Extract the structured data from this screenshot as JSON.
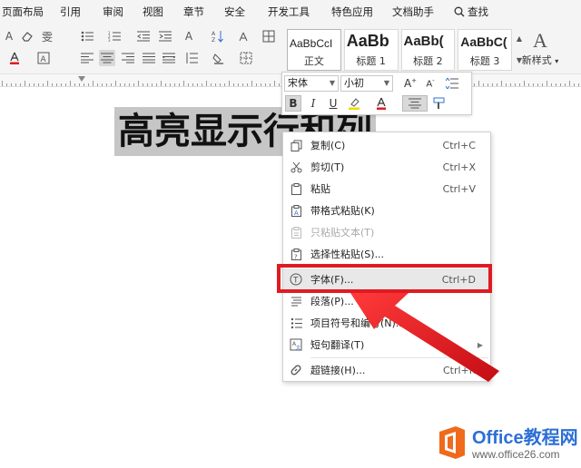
{
  "menubar": {
    "items": [
      "页面布局",
      "引用",
      "审阅",
      "视图",
      "章节",
      "安全",
      "开发工具",
      "特色应用",
      "文档助手"
    ],
    "search_label": "查找"
  },
  "ribbon": {
    "styles": [
      {
        "sample": "AaBbCcI",
        "name": "正文"
      },
      {
        "sample": "AaBb",
        "name": "标题 1"
      },
      {
        "sample": "AaBb(",
        "name": "标题 2"
      },
      {
        "sample": "AaBbC(",
        "name": "标题 3"
      }
    ],
    "new_style_label": "新样式",
    "new_style_glyph": "A"
  },
  "document": {
    "heading": "高亮显示行和列"
  },
  "minibar": {
    "font_name": "宋体",
    "font_size": "小初"
  },
  "context_menu": {
    "items": [
      {
        "label": "复制(C)",
        "shortcut": "Ctrl+C",
        "icon": "copy-icon",
        "enabled": true
      },
      {
        "label": "剪切(T)",
        "shortcut": "Ctrl+X",
        "icon": "scissors-icon",
        "enabled": true
      },
      {
        "label": "粘贴",
        "shortcut": "Ctrl+V",
        "icon": "paste-icon",
        "enabled": true
      },
      {
        "label": "带格式粘贴(K)",
        "shortcut": "",
        "icon": "paste-format-icon",
        "enabled": true
      },
      {
        "label": "只粘贴文本(T)",
        "shortcut": "",
        "icon": "paste-text-icon",
        "enabled": false
      },
      {
        "label": "选择性粘贴(S)...",
        "shortcut": "",
        "icon": "paste-special-icon",
        "enabled": true
      },
      {
        "label": "字体(F)...",
        "shortcut": "Ctrl+D",
        "icon": "font-icon",
        "enabled": true
      },
      {
        "label": "段落(P)...",
        "shortcut": "",
        "icon": "paragraph-icon",
        "enabled": true
      },
      {
        "label": "项目符号和编号(N)...",
        "shortcut": "",
        "icon": "bullets-icon",
        "enabled": true
      },
      {
        "label": "短句翻译(T)",
        "shortcut": "",
        "icon": "translate-icon",
        "enabled": true,
        "submenu": true
      },
      {
        "label": "超链接(H)...",
        "shortcut": "Ctrl+K",
        "icon": "link-icon",
        "enabled": true
      }
    ]
  },
  "watermark": {
    "brand": "Office",
    "brand_cn": "教程网",
    "url": "www.office26.com"
  },
  "colors": {
    "highlight_red": "#e11a22",
    "selection_gray": "#c6c6c6",
    "brand_blue": "#2c6fd6",
    "brand_orange": "#f06a1b"
  }
}
